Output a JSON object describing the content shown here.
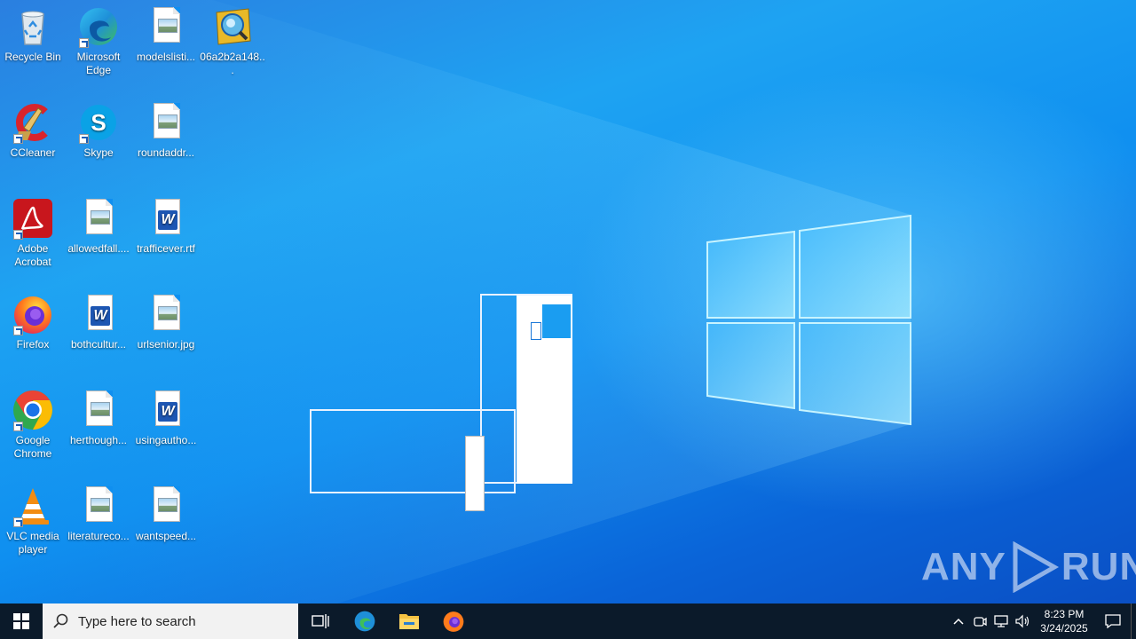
{
  "desktop": {
    "icons": [
      {
        "label": "Recycle Bin",
        "icon": "recycle-bin-icon"
      },
      {
        "label": "Microsoft Edge",
        "icon": "edge-icon"
      },
      {
        "label": "modelslisti...",
        "icon": "image-file-icon"
      },
      {
        "label": "06a2b2a148...",
        "icon": "app-icon"
      },
      {
        "label": "CCleaner",
        "icon": "ccleaner-icon"
      },
      {
        "label": "Skype",
        "icon": "skype-icon"
      },
      {
        "label": "roundaddr...",
        "icon": "image-file-icon"
      },
      {
        "label": "Adobe Acrobat",
        "icon": "acrobat-icon"
      },
      {
        "label": "allowedfall....",
        "icon": "image-file-icon"
      },
      {
        "label": "trafficever.rtf",
        "icon": "word-doc-icon"
      },
      {
        "label": "Firefox",
        "icon": "firefox-icon"
      },
      {
        "label": "bothcultur...",
        "icon": "word-doc-icon"
      },
      {
        "label": "urlsenior.jpg",
        "icon": "image-file-icon"
      },
      {
        "label": "Google Chrome",
        "icon": "chrome-icon"
      },
      {
        "label": "herthough...",
        "icon": "image-file-icon"
      },
      {
        "label": "usingautho...",
        "icon": "word-doc-icon"
      },
      {
        "label": "VLC media player",
        "icon": "vlc-icon"
      },
      {
        "label": "literatureco...",
        "icon": "image-file-icon"
      },
      {
        "label": "wantspeed...",
        "icon": "image-file-icon"
      }
    ]
  },
  "taskbar": {
    "search_placeholder": "Type here to search",
    "time": "8:23 PM",
    "date": "3/24/2025"
  },
  "watermark": {
    "text_left": "ANY",
    "text_right": "RUN"
  }
}
